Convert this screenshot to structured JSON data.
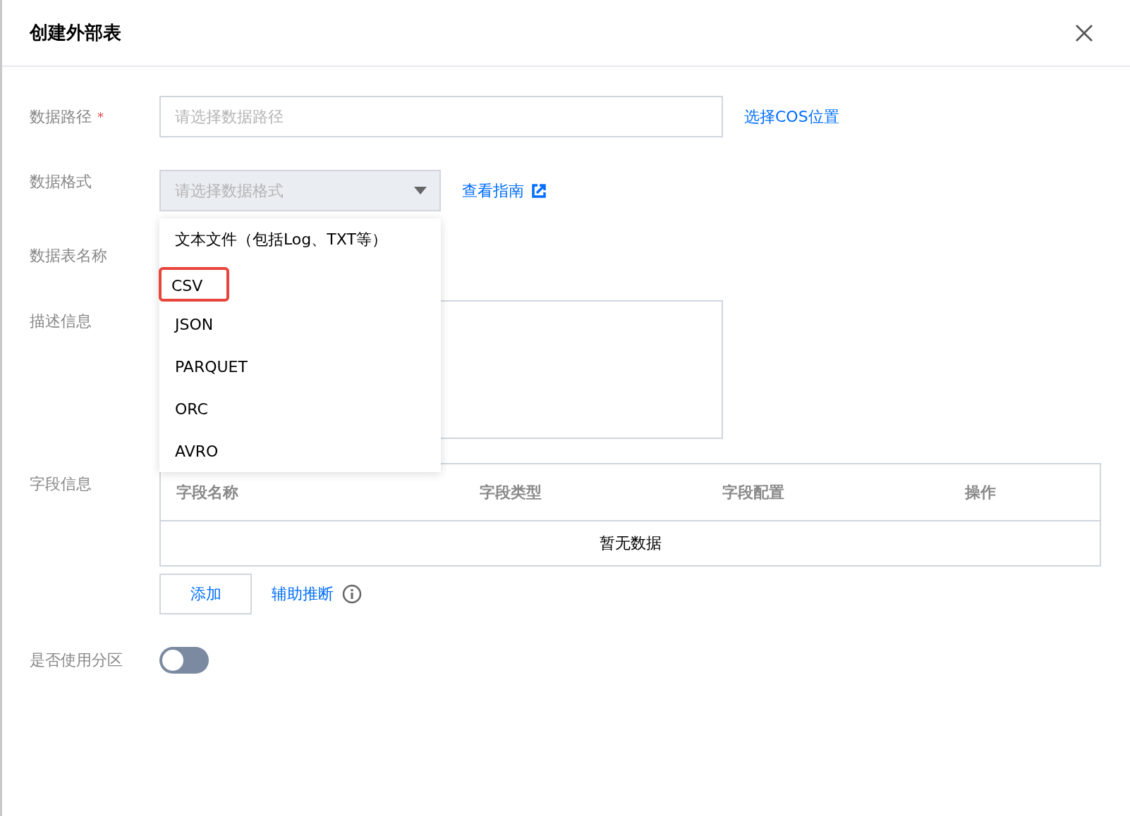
{
  "dialog": {
    "title": "创建外部表"
  },
  "form": {
    "data_path": {
      "label": "数据路径",
      "required_mark": "*",
      "placeholder": "请选择数据路径",
      "link": "选择COS位置"
    },
    "data_format": {
      "label": "数据格式",
      "placeholder": "请选择数据格式",
      "link": "查看指南",
      "options": [
        {
          "label": "文本文件（包括Log、TXT等）",
          "highlighted": false
        },
        {
          "label": "CSV",
          "highlighted": true
        },
        {
          "label": "JSON",
          "highlighted": false
        },
        {
          "label": "PARQUET",
          "highlighted": false
        },
        {
          "label": "ORC",
          "highlighted": false
        },
        {
          "label": "AVRO",
          "highlighted": false
        }
      ]
    },
    "table_name": {
      "label": "数据表名称"
    },
    "description": {
      "label": "描述信息"
    },
    "fields": {
      "label": "字段信息",
      "columns": [
        "字段名称",
        "字段类型",
        "字段配置",
        "操作"
      ],
      "empty_text": "暂无数据",
      "add_button": "添加",
      "infer_link": "辅助推断"
    },
    "partition": {
      "label": "是否使用分区",
      "on": false
    }
  }
}
